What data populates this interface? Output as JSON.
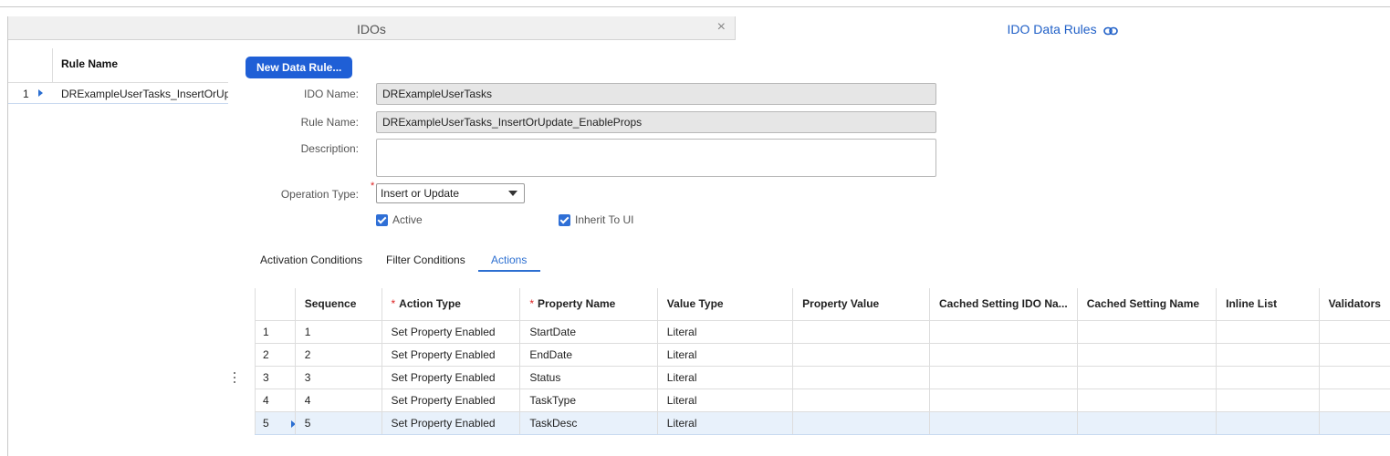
{
  "tabs": {
    "ido_label": "IDOs",
    "close_glyph": "×",
    "rules_label": "IDO Data Rules"
  },
  "left_grid": {
    "column_header": "Rule Name",
    "rows": [
      {
        "num": "1",
        "value": "DRExampleUserTasks_InsertOrUp"
      }
    ]
  },
  "form": {
    "new_button": "New Data Rule...",
    "ido_name_label": "IDO Name:",
    "ido_name_value": "DRExampleUserTasks",
    "rule_name_label": "Rule Name:",
    "rule_name_value": "DRExampleUserTasks_InsertOrUpdate_EnableProps",
    "description_label": "Description:",
    "description_value": "",
    "operation_type_label": "Operation Type:",
    "operation_type_value": "Insert or Update",
    "active_label": "Active",
    "inherit_label": "Inherit To UI",
    "required_mark": "*"
  },
  "subtabs": [
    "Activation Conditions",
    "Filter Conditions",
    "Actions"
  ],
  "actions_grid": {
    "columns": [
      "Sequence",
      "Action Type",
      "Property Name",
      "Value Type",
      "Property Value",
      "Cached Setting IDO Na...",
      "Cached Setting Name",
      "Inline List",
      "Validators"
    ],
    "rows": [
      {
        "num": "1",
        "sequence": "1",
        "action_type": "Set Property Enabled",
        "property_name": "StartDate",
        "value_type": "Literal"
      },
      {
        "num": "2",
        "sequence": "2",
        "action_type": "Set Property Enabled",
        "property_name": "EndDate",
        "value_type": "Literal"
      },
      {
        "num": "3",
        "sequence": "3",
        "action_type": "Set Property Enabled",
        "property_name": "Status",
        "value_type": "Literal"
      },
      {
        "num": "4",
        "sequence": "4",
        "action_type": "Set Property Enabled",
        "property_name": "TaskType",
        "value_type": "Literal"
      },
      {
        "num": "5",
        "sequence": "5",
        "action_type": "Set Property Enabled",
        "property_name": "TaskDesc",
        "value_type": "Literal"
      }
    ]
  },
  "colors": {
    "accent": "#1f5fd6",
    "link": "#2c6fd1",
    "required": "#dd2222",
    "selected_row": "#e8f1fb"
  },
  "icons": [
    "close-icon",
    "link-icon",
    "row-selector-arrow-icon",
    "dropdown-caret-icon",
    "checkbox-checked-icon",
    "kebab-menu-icon"
  ]
}
